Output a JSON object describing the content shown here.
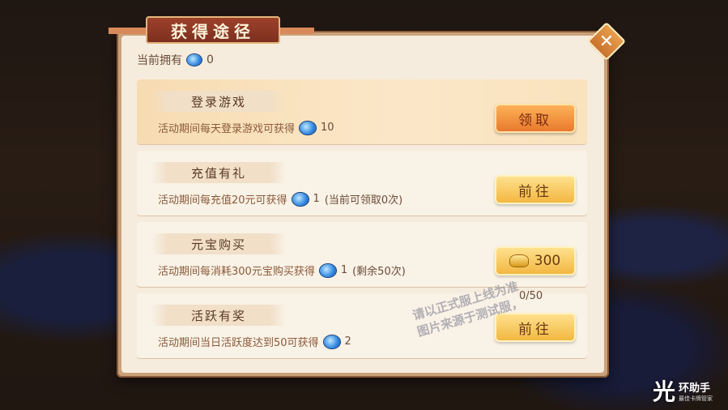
{
  "dialog": {
    "title": "获得途径",
    "close_label": "✕",
    "owned_label": "当前拥有",
    "owned_count": "0"
  },
  "rows": [
    {
      "label": "登录游戏",
      "desc": "活动期间每天登录游戏可获得",
      "amount": "10",
      "extra": "",
      "button": "领取",
      "button_kind": "claim",
      "progress": ""
    },
    {
      "label": "充值有礼",
      "desc": "活动期间每充值20元可获得",
      "amount": "1",
      "extra": "(当前可领取0次)",
      "button": "前往",
      "button_kind": "go",
      "progress": ""
    },
    {
      "label": "元宝购买",
      "desc": "活动期间每消耗300元宝购买获得",
      "amount": "1",
      "extra": "(剩余50次)",
      "button": "300",
      "button_kind": "cost",
      "progress": ""
    },
    {
      "label": "活跃有奖",
      "desc": "活动期间当日活跃度达到50可获得",
      "amount": "2",
      "extra": "",
      "button": "前往",
      "button_kind": "go",
      "progress": "0/50"
    }
  ],
  "icons": {
    "currency": "blue-gem-icon",
    "ingot": "gold-ingot-icon"
  },
  "watermark": {
    "line1": "请以正式服上线为准",
    "line2": "图片来源于测试服，"
  },
  "logo": {
    "mark": "光",
    "name": "环助手",
    "tagline": "最佳卡牌管家"
  }
}
